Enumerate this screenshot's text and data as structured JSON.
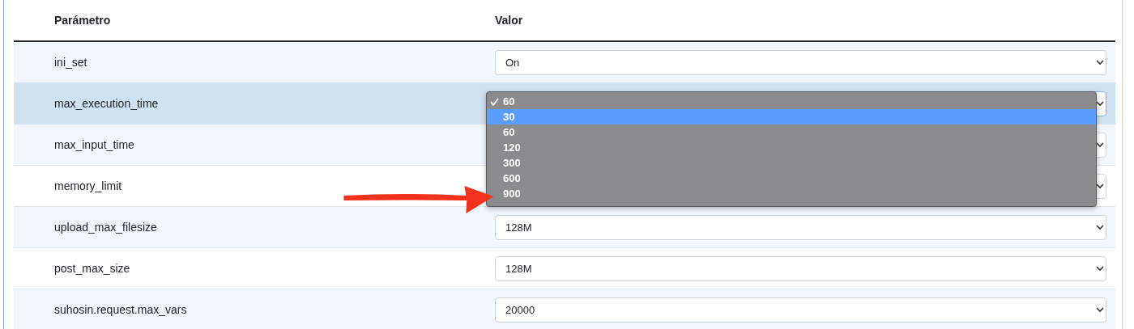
{
  "table": {
    "columns": [
      "Parámetro",
      "Valor"
    ],
    "rows": [
      {
        "parameter": "ini_set",
        "value": "On",
        "highlighted": false
      },
      {
        "parameter": "max_execution_time",
        "highlighted": true,
        "dropdown": {
          "options": [
            {
              "label": "60",
              "checked": true,
              "highlighted": false
            },
            {
              "label": "30",
              "checked": false,
              "highlighted": true
            },
            {
              "label": "60",
              "checked": false,
              "highlighted": false
            },
            {
              "label": "120",
              "checked": false,
              "highlighted": false
            },
            {
              "label": "300",
              "checked": false,
              "highlighted": false
            },
            {
              "label": "600",
              "checked": false,
              "highlighted": false
            },
            {
              "label": "900",
              "checked": false,
              "highlighted": false
            }
          ]
        }
      },
      {
        "parameter": "max_input_time",
        "highlighted": false
      },
      {
        "parameter": "memory_limit",
        "highlighted": false
      },
      {
        "parameter": "upload_max_filesize",
        "value": "128M",
        "highlighted": false
      },
      {
        "parameter": "post_max_size",
        "value": "128M",
        "highlighted": false
      },
      {
        "parameter": "suhosin.request.max_vars",
        "value": "20000",
        "highlighted": false
      }
    ]
  }
}
